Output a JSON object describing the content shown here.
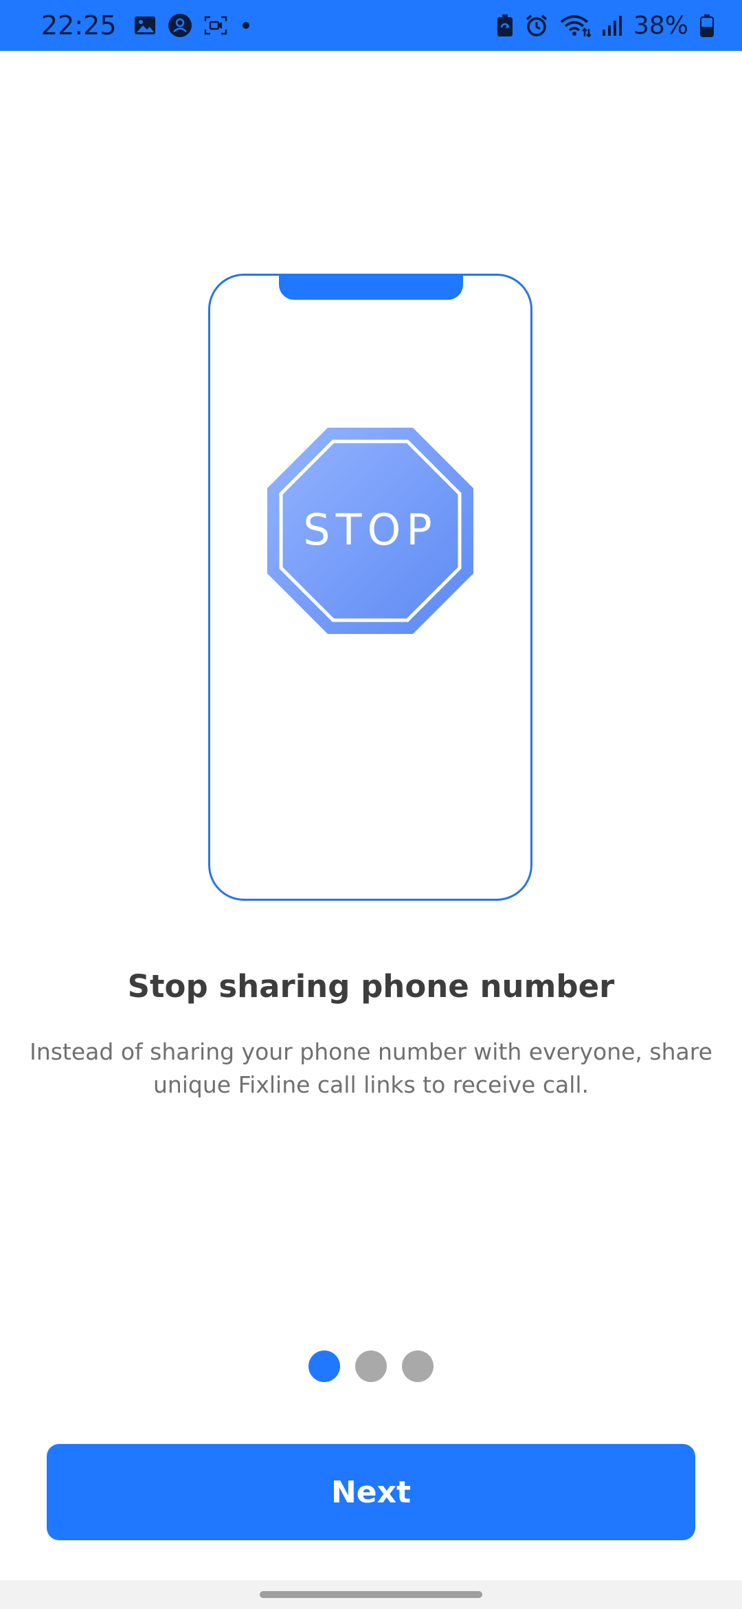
{
  "status_bar": {
    "time": "22:25",
    "battery": "38%",
    "icons": [
      "gallery-icon",
      "account-icon",
      "screen-capture-icon",
      "notification-dot-icon",
      "battery-saver-icon",
      "alarm-icon",
      "wifi-icon",
      "signal-icon",
      "battery-icon"
    ]
  },
  "illustration": {
    "stop_sign_text": "STOP",
    "colors": {
      "frame": "#2a74e6",
      "notch": "#1f78ff",
      "sign_light": "#8fb0ff",
      "sign_dark": "#5f8df5"
    }
  },
  "onboarding": {
    "title": "Stop sharing phone number",
    "description_line1": "Instead of sharing your phone number with everyone, share",
    "description_line2": "unique Fixline call links to receive call."
  },
  "pager": {
    "total": 3,
    "active_index": 0
  },
  "next_button": {
    "label": "Next"
  },
  "theme": {
    "accent": "#1f78ff",
    "title_color": "#3d3d3d",
    "body_color": "#6f6f6f",
    "inactive_dot": "#a9a9a9"
  }
}
